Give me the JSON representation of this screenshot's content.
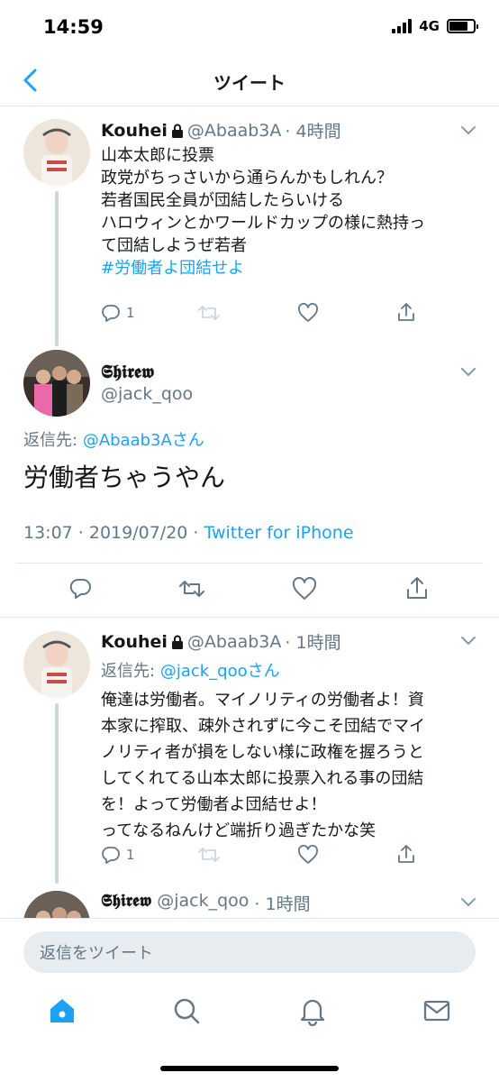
{
  "status": {
    "time": "14:59",
    "network": "4G"
  },
  "nav": {
    "title": "ツイート"
  },
  "colors": {
    "accent": "#1da1f2",
    "secondary_text": "#657786",
    "divider": "#e1e8ed"
  },
  "tweets": [
    {
      "name": "Kouhei",
      "handle": "@Abaab3A",
      "time": "· 4時間",
      "lines": [
        "山本太郎に投票",
        "政党がちっさいから通らんかもしれん？",
        "若者国民全員が団結したらいける",
        "ハロウィンとかワールドカップの様に熱持っ",
        "て団結しようぜ若者"
      ],
      "hashtag": "#労働者よ団結せよ",
      "reply_count": "1"
    }
  ],
  "main_tweet": {
    "name": "𝕾𝖍𝖎𝖗𝖊𝖜",
    "handle": "@jack_qoo",
    "reply_to_label": "返信先:",
    "reply_to_target": "@Abaab3Aさん",
    "text": "労働者ちゃうやん",
    "timestamp": "13:07 · 2019/07/20 · ",
    "source": "Twitter for iPhone"
  },
  "reply_tweet": {
    "name": "Kouhei",
    "handle": "@Abaab3A",
    "time": "· 1時間",
    "reply_to_label": "返信先:",
    "reply_to_target": "@jack_qooさん",
    "lines": [
      "俺達は労働者。マイノリティの労働者よ！資",
      "本家に搾取、疎外されずに今こそ団結でマイ",
      "ノリティ者が損をしない様に政権を握ろうと",
      "してくれてる山本太郎に投票入れる事の団結",
      "を！よって労働者よ団結せよ！",
      "ってなるねんけど端折り過ぎたかな笑"
    ],
    "reply_count": "1"
  },
  "partial_tweet": {
    "name": "𝕾𝖍𝖎𝖗𝖊𝖜",
    "handle": "@jack_qoo",
    "time": "· 1時間"
  },
  "reply_bar": {
    "placeholder": "返信をツイート"
  },
  "tabs": [
    "home-icon",
    "search-icon",
    "notifications-icon",
    "messages-icon"
  ]
}
